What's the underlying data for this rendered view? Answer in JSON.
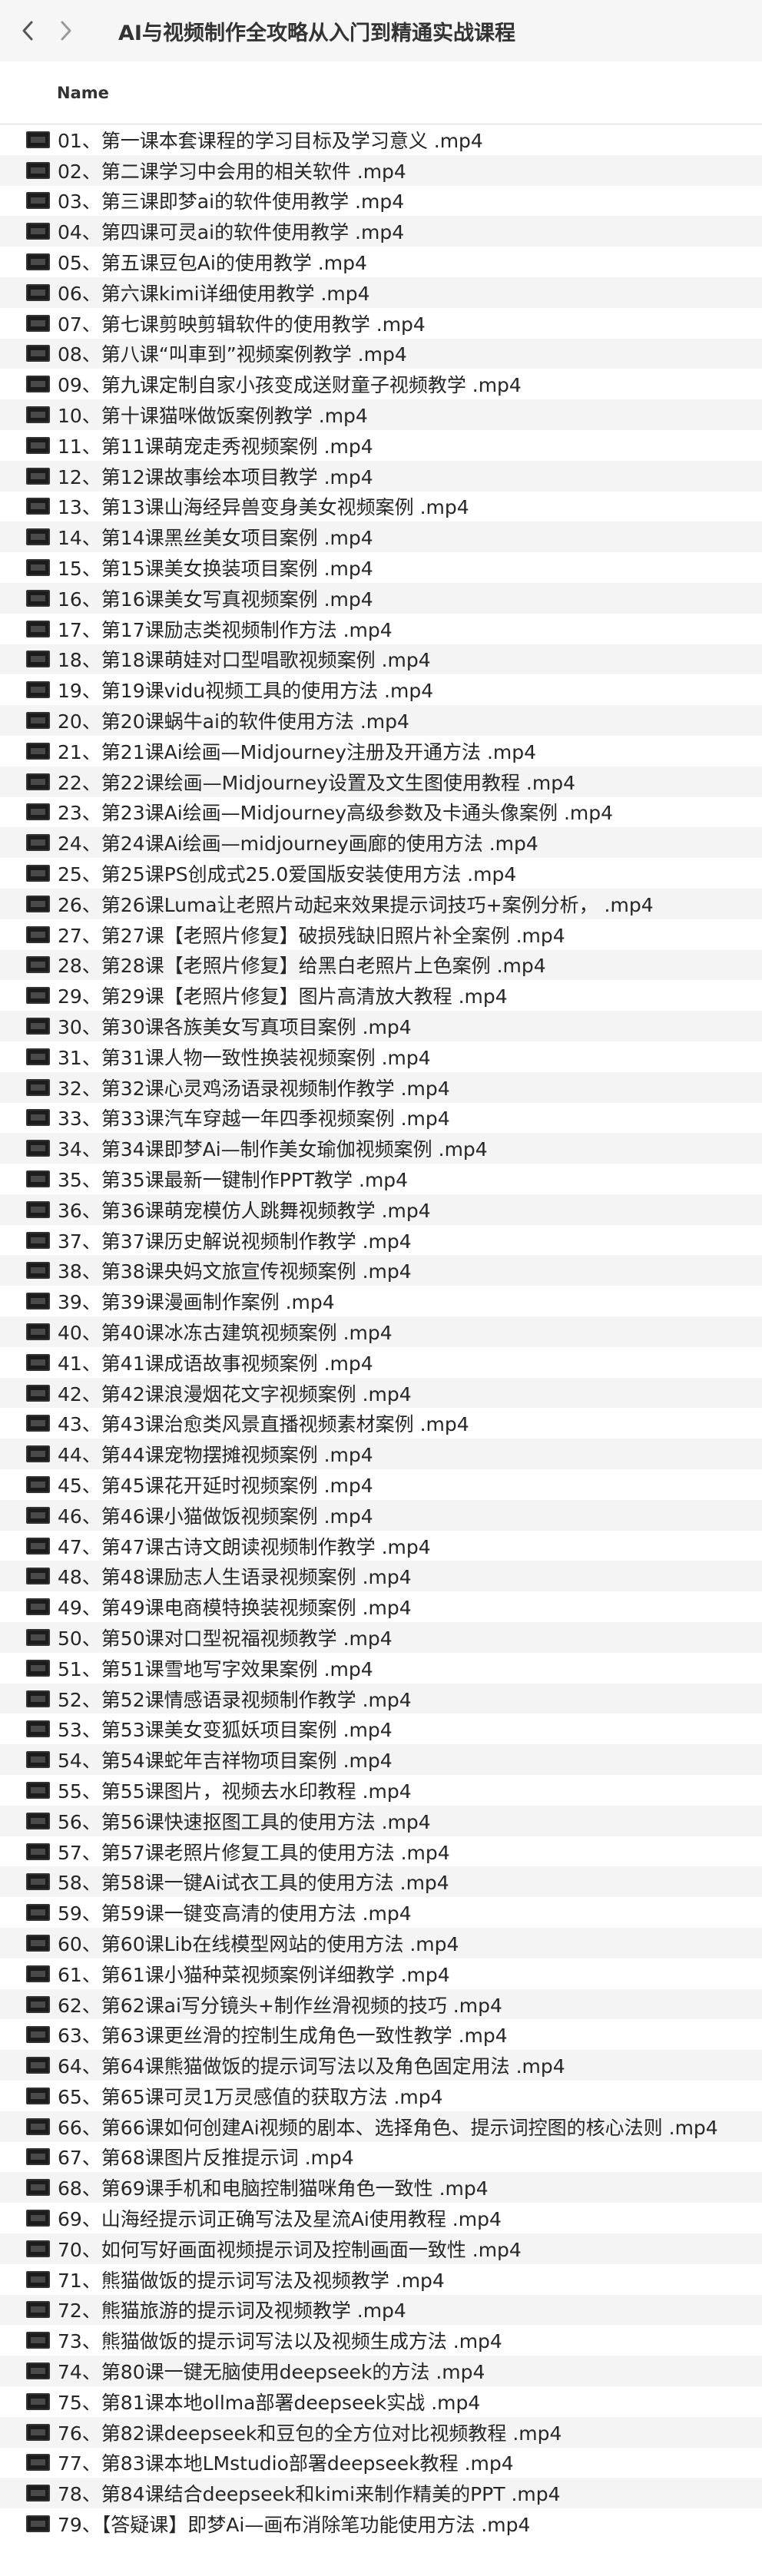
{
  "window": {
    "title": "AI与视频制作全攻略从入门到精通实战课程"
  },
  "nav": {
    "back_icon": "chevron-left-icon",
    "forward_icon": "chevron-right-icon"
  },
  "columns": {
    "name_header": "Name"
  },
  "files": [
    "01、第一课本套课程的学习目标及学习意义 .mp4",
    "02、第二课学习中会用的相关软件 .mp4",
    "03、第三课即梦ai的软件使用教学 .mp4",
    "04、第四课可灵ai的软件使用教学 .mp4",
    "05、第五课豆包Ai的使用教学 .mp4",
    "06、第六课kimi详细使用教学 .mp4",
    "07、第七课剪映剪辑软件的使用教学 .mp4",
    "08、第八课“叫車到”视频案例教学 .mp4",
    "09、第九课定制自家小孩变成送财童子视频教学 .mp4",
    "10、第十课猫咪做饭案例教学 .mp4",
    "11、第11课萌宠走秀视频案例 .mp4",
    "12、第12课故事绘本项目教学 .mp4",
    "13、第13课山海经异兽变身美女视频案例 .mp4",
    "14、第14课黑丝美女项目案例 .mp4",
    "15、第15课美女换装项目案例 .mp4",
    "16、第16课美女写真视频案例 .mp4",
    "17、第17课励志类视频制作方法 .mp4",
    "18、第18课萌娃对口型唱歌视频案例 .mp4",
    "19、第19课vidu视频工具的使用方法 .mp4",
    "20、第20课蜗牛ai的软件使用方法 .mp4",
    "21、第21课Ai绘画—Midjourney注册及开通方法 .mp4",
    "22、第22课绘画—Midjourney设置及文生图使用教程 .mp4",
    "23、第23课Ai绘画—Midjourney高级参数及卡通头像案例 .mp4",
    "24、第24课Ai绘画—midjourney画廊的使用方法 .mp4",
    "25、第25课PS创成式25.0爱国版安装使用方法 .mp4",
    "26、第26课Luma让老照片动起来效果提示词技巧+案例分析，  .mp4",
    "27、第27课【老照片修复】破损残缺旧照片补全案例 .mp4",
    "28、第28课【老照片修复】给黑白老照片上色案例 .mp4",
    "29、第29课【老照片修复】图片高清放大教程 .mp4",
    "30、第30课各族美女写真项目案例 .mp4",
    "31、第31课人物一致性换装视频案例 .mp4",
    "32、第32课心灵鸡汤语录视频制作教学 .mp4",
    "33、第33课汽车穿越一年四季视频案例 .mp4",
    "34、第34课即梦Ai—制作美女瑜伽视频案例 .mp4",
    "35、第35课最新一键制作PPT教学 .mp4",
    "36、第36课萌宠模仿人跳舞视频教学 .mp4",
    "37、第37课历史解说视频制作教学 .mp4",
    "38、第38课央妈文旅宣传视频案例 .mp4",
    "39、第39课漫画制作案例 .mp4",
    "40、第40课冰冻古建筑视频案例 .mp4",
    "41、第41课成语故事视频案例 .mp4",
    "42、第42课浪漫烟花文字视频案例 .mp4",
    "43、第43课治愈类风景直播视频素材案例 .mp4",
    "44、第44课宠物摆摊视频案例 .mp4",
    "45、第45课花开延时视频案例 .mp4",
    "46、第46课小猫做饭视频案例 .mp4",
    "47、第47课古诗文朗读视频制作教学 .mp4",
    "48、第48课励志人生语录视频案例 .mp4",
    "49、第49课电商模特换装视频案例 .mp4",
    "50、第50课对口型祝福视频教学 .mp4",
    "51、第51课雪地写字效果案例 .mp4",
    "52、第52课情感语录视频制作教学 .mp4",
    "53、第53课美女变狐妖项目案例 .mp4",
    "54、第54课蛇年吉祥物项目案例 .mp4",
    "55、第55课图片，视频去水印教程 .mp4",
    "56、第56课快速抠图工具的使用方法 .mp4",
    "57、第57课老照片修复工具的使用方法 .mp4",
    "58、第58课一键Ai试衣工具的使用方法 .mp4",
    "59、第59课一键变高清的使用方法 .mp4",
    "60、第60课Lib在线模型网站的使用方法 .mp4",
    "61、第61课小猫种菜视频案例详细教学 .mp4",
    "62、第62课ai写分镜头+制作丝滑视频的技巧 .mp4",
    "63、第63课更丝滑的控制生成角色一致性教学 .mp4",
    "64、第64课熊猫做饭的提示词写法以及角色固定用法 .mp4",
    "65、第65课可灵1万灵感值的获取方法 .mp4",
    "66、第66课如何创建Ai视频的剧本、选择角色、提示词控图的核心法则 .mp4",
    "67、第68课图片反推提示词 .mp4",
    "68、第69课手机和电脑控制猫咪角色一致性 .mp4",
    "69、山海经提示词正确写法及星流Ai使用教程 .mp4",
    "70、如何写好画面视频提示词及控制画面一致性 .mp4",
    "71、熊猫做饭的提示词写法及视频教学 .mp4",
    "72、熊猫旅游的提示词及视频教学 .mp4",
    "73、熊猫做饭的提示词写法以及视频生成方法 .mp4",
    "74、第80课一键无脑使用deepseek的方法 .mp4",
    "75、第81课本地ollma部署deepseek实战 .mp4",
    "76、第82课deepseek和豆包的全方位对比视频教程 .mp4",
    "77、第83课本地LMstudio部署deepseek教程 .mp4",
    "78、第84课结合deepseek和kimi来制作精美的PPT .mp4",
    "79、【答疑课】即梦Ai—画布消除笔功能使用方法 .mp4"
  ]
}
